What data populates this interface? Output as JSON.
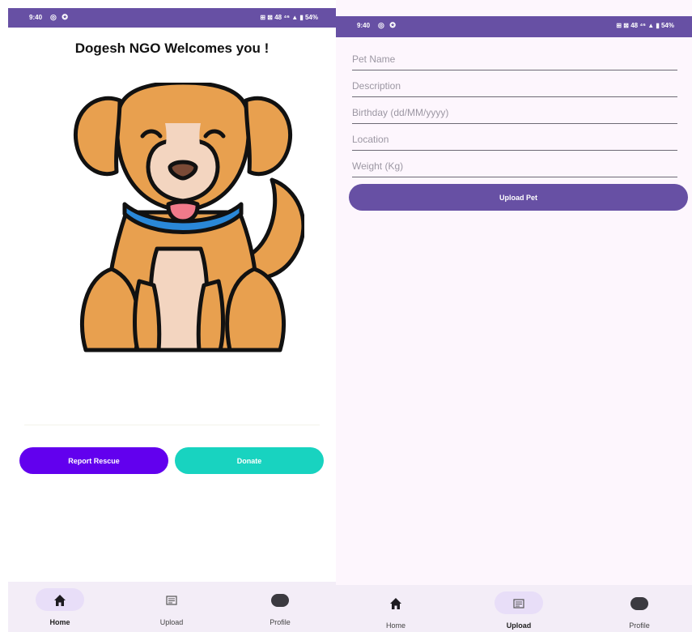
{
  "status_bar": {
    "time": "9:40",
    "icons_left": "◎ ✪",
    "icons_right": "⊞ ⊠ 48 ⁴⁶ ▲ ▮ 54%"
  },
  "home": {
    "title": "Dogesh NGO Welcomes you !",
    "report_label": "Report Rescue",
    "donate_label": "Donate"
  },
  "upload": {
    "fields": [
      {
        "placeholder": "Pet Name"
      },
      {
        "placeholder": "Description"
      },
      {
        "placeholder": "Birthday (dd/MM/yyyy)"
      },
      {
        "placeholder": "Location"
      },
      {
        "placeholder": "Weight (Kg)"
      }
    ],
    "upload_label": "Upload Pet"
  },
  "nav": {
    "home": "Home",
    "upload": "Upload",
    "profile": "Profile"
  },
  "colors": {
    "primary": "#6750a4",
    "report": "#6200ee",
    "donate": "#18d3c0",
    "navbar": "#f3edf7",
    "nav_active_pill": "#e8def8"
  },
  "icons": {
    "home": "home-icon",
    "upload": "upload-icon",
    "profile": "profile-icon",
    "dog": "dog-illustration"
  }
}
